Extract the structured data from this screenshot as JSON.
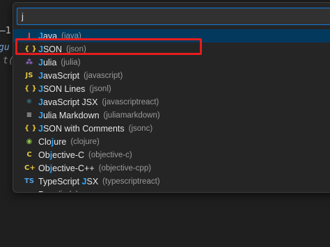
{
  "editor": {
    "fragment_1": "–1",
    "fragment_2": "gu",
    "fragment_3": "t("
  },
  "quick_pick": {
    "search_value": "j",
    "items": [
      {
        "icon_char": "J",
        "icon_color": "#e8513a",
        "icon": "java-icon",
        "pre": "",
        "match": "J",
        "post": "ava",
        "desc": "(java)"
      },
      {
        "icon_char": "{ }",
        "icon_color": "#e6c640",
        "icon": "json-icon",
        "pre": "",
        "match": "J",
        "post": "SON",
        "desc": "(json)"
      },
      {
        "icon_char": "⁂",
        "icon_color": "#9c6fd1",
        "icon": "julia-icon",
        "pre": "",
        "match": "J",
        "post": "ulia",
        "desc": "(julia)"
      },
      {
        "icon_char": "JS",
        "icon_color": "#e6c640",
        "icon": "javascript-icon",
        "pre": "",
        "match": "J",
        "post": "avaScript",
        "desc": "(javascript)"
      },
      {
        "icon_char": "{ }",
        "icon_color": "#e6c640",
        "icon": "json-lines-icon",
        "pre": "",
        "match": "J",
        "post": "SON Lines",
        "desc": "(jsonl)"
      },
      {
        "icon_char": "⚛",
        "icon_color": "#4fb6d9",
        "icon": "react-icon",
        "pre": "",
        "match": "J",
        "post": "avaScript JSX",
        "desc": "(javascriptreact)"
      },
      {
        "icon_char": "≡",
        "icon_color": "#c8c8c8",
        "icon": "markdown-icon",
        "pre": "",
        "match": "J",
        "post": "ulia Markdown",
        "desc": "(juliamarkdown)"
      },
      {
        "icon_char": "{ }",
        "icon_color": "#e6c640",
        "icon": "json-comments-icon",
        "pre": "",
        "match": "J",
        "post": "SON with Comments",
        "desc": "(jsonc)"
      },
      {
        "icon_char": "◉",
        "icon_color": "#8dc149",
        "icon": "clojure-icon",
        "pre": "Clo",
        "match": "j",
        "post": "ure",
        "desc": "(clojure)"
      },
      {
        "icon_char": "C",
        "icon_color": "#e6c640",
        "icon": "objective-c-icon",
        "pre": "Ob",
        "match": "j",
        "post": "ective-C",
        "desc": "(objective-c)"
      },
      {
        "icon_char": "C+",
        "icon_color": "#e6c640",
        "icon": "objective-cpp-icon",
        "pre": "Ob",
        "match": "j",
        "post": "ective-C++",
        "desc": "(objective-cpp)"
      },
      {
        "icon_char": "TS",
        "icon_color": "#4fa0e0",
        "icon": "typescript-icon",
        "pre": "TypeScript ",
        "match": "J",
        "post": "SX",
        "desc": "(typescriptreact)"
      },
      {
        "icon_char": "▲",
        "icon_color": "#e8513a",
        "icon": "pug-icon",
        "pre": "Pug",
        "match": "",
        "post": "",
        "desc": "(jade)"
      }
    ]
  },
  "colors": {
    "selection": "#04395e",
    "match": "#2aaaff",
    "highlight_box": "#e41d1d"
  }
}
